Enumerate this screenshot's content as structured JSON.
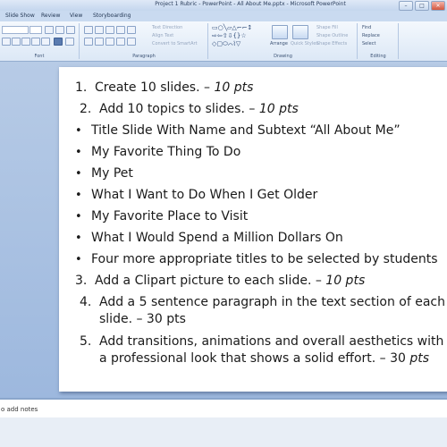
{
  "window": {
    "title": "Project 1 Rubric - PowerPoint - All About Me.pptx - Microsoft PowerPoint",
    "minimize": "–",
    "maximize": "□",
    "close": "✕"
  },
  "menu": {
    "tabs": [
      "Slide Show",
      "Review",
      "View",
      "Storyboarding"
    ]
  },
  "ribbon": {
    "groups": {
      "font": "Font",
      "paragraph": "Paragraph",
      "drawing": "Drawing",
      "editing": "Editing"
    },
    "paragraph_items": [
      "Text Direction",
      "Align Text",
      "Convert to SmartArt"
    ],
    "drawing_items": [
      "Shape Fill",
      "Shape Outline",
      "Shape Effects"
    ],
    "arrange": "Arrange",
    "quick_styles": "Quick Styles",
    "editing_items": [
      "Find",
      "Replace",
      "Select"
    ]
  },
  "slide": {
    "items": [
      {
        "marker": "1.",
        "text": "Create 10 slides. – ",
        "pts": "10 pts",
        "type": "number"
      },
      {
        "marker": "2.",
        "text": "Add 10 topics to slides. – ",
        "pts": "10 pts",
        "type": "number"
      },
      {
        "marker": "•",
        "text": "Title Slide With Name and Subtext “All About Me”",
        "pts": "",
        "type": "bullet"
      },
      {
        "marker": "•",
        "text": "My Favorite Thing To Do",
        "pts": "",
        "type": "bullet"
      },
      {
        "marker": "•",
        "text": "My Pet",
        "pts": "",
        "type": "bullet"
      },
      {
        "marker": "•",
        "text": "What I Want to Do When I Get Older",
        "pts": "",
        "type": "bullet"
      },
      {
        "marker": "•",
        "text": "My Favorite Place to Visit",
        "pts": "",
        "type": "bullet"
      },
      {
        "marker": "•",
        "text": "What I Would Spend a Million Dollars On",
        "pts": "",
        "type": "bullet"
      },
      {
        "marker": "•",
        "text": "Four more appropriate titles to be selected by students",
        "pts": "",
        "type": "bullet"
      },
      {
        "marker": "3.",
        "text": "Add a Clipart picture to each slide. – ",
        "pts": "10 pts",
        "type": "number"
      },
      {
        "marker": "4.",
        "text": "Add a 5 sentence paragraph in the text section of each",
        "pts": "",
        "type": "number"
      },
      {
        "marker": "",
        "text": "slide. – 30 pts",
        "pts": "",
        "type": "cont"
      },
      {
        "marker": "5.",
        "text": "Add transitions, animations and overall aesthetics with",
        "pts": "",
        "type": "number"
      },
      {
        "marker": "",
        "text": "a professional look that shows a solid effort. – 30 ",
        "pts": "pts",
        "type": "cont"
      }
    ]
  },
  "notes": {
    "placeholder": "Click to add notes",
    "visible": "o add notes"
  }
}
